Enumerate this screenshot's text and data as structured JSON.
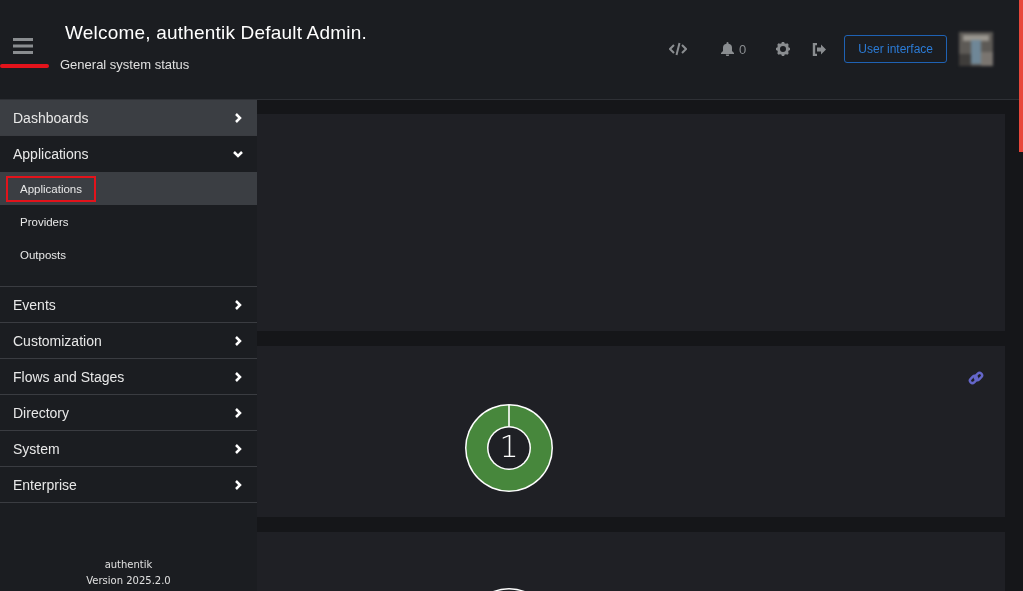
{
  "header": {
    "title": "Welcome, authentik Default Admin.",
    "subtitle": "General system status",
    "menu_highlighted": true,
    "notifications": "0",
    "user_interface_button": "User interface"
  },
  "sidebar": {
    "items": [
      {
        "label": "Dashboards",
        "selected": true,
        "expanded": false
      },
      {
        "label": "Applications",
        "selected": false,
        "expanded": true,
        "children": [
          {
            "label": "Applications",
            "selected": true,
            "highlighted": true
          },
          {
            "label": "Providers",
            "selected": false,
            "highlighted": false
          },
          {
            "label": "Outposts",
            "selected": false,
            "highlighted": false
          }
        ]
      },
      {
        "label": "Events",
        "selected": false,
        "expanded": false
      },
      {
        "label": "Customization",
        "selected": false,
        "expanded": false
      },
      {
        "label": "Flows and Stages",
        "selected": false,
        "expanded": false
      },
      {
        "label": "Directory",
        "selected": false,
        "expanded": false
      },
      {
        "label": "System",
        "selected": false,
        "expanded": false
      },
      {
        "label": "Enterprise",
        "selected": false,
        "expanded": false
      }
    ],
    "footer": {
      "product": "authentik",
      "version": "Version 2025.2.0"
    }
  },
  "cards": [
    {
      "kind": "empty"
    },
    {
      "kind": "donut",
      "count": "1",
      "color": "#47873c",
      "link": true
    },
    {
      "kind": "partial"
    }
  ]
}
